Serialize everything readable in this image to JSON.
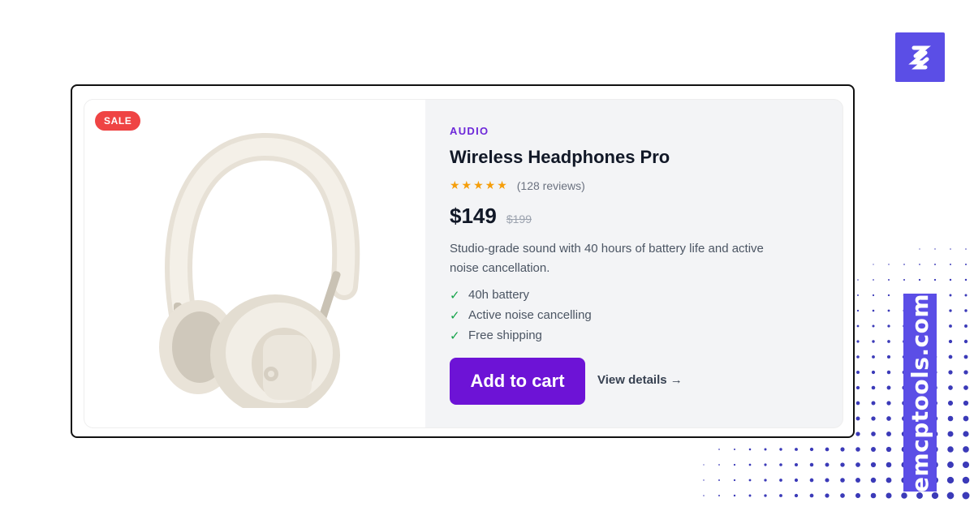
{
  "badge": {
    "label": "SALE",
    "color": "#ef4444"
  },
  "product": {
    "category": "AUDIO",
    "title": "Wireless Headphones Pro",
    "rating": {
      "stars": "★★★★★",
      "value": 5,
      "reviews_text": "(128 reviews)"
    },
    "price": "$149",
    "original_price": "$199",
    "description": "Studio-grade sound with 40 hours of battery life and active noise cancellation.",
    "features": [
      {
        "icon": "check-icon",
        "glyph": "✓",
        "text": "40h battery"
      },
      {
        "icon": "check-icon",
        "glyph": "✓",
        "text": "Active noise cancelling"
      },
      {
        "icon": "check-icon",
        "glyph": "✓",
        "text": "Free shipping"
      }
    ],
    "image": {
      "icon": "headphones-image"
    }
  },
  "actions": {
    "add_to_cart": "Add to cart",
    "view_details": "View details →"
  },
  "brand": {
    "site": "emcptools.com",
    "logo_icon": "brand-logo-icon"
  },
  "colors": {
    "accent": "#6d13d6",
    "category": "#6d28d9",
    "brand": "#5b4ee6",
    "stars": "#f59e0b",
    "check": "#16a34a",
    "sale": "#ef4444"
  }
}
